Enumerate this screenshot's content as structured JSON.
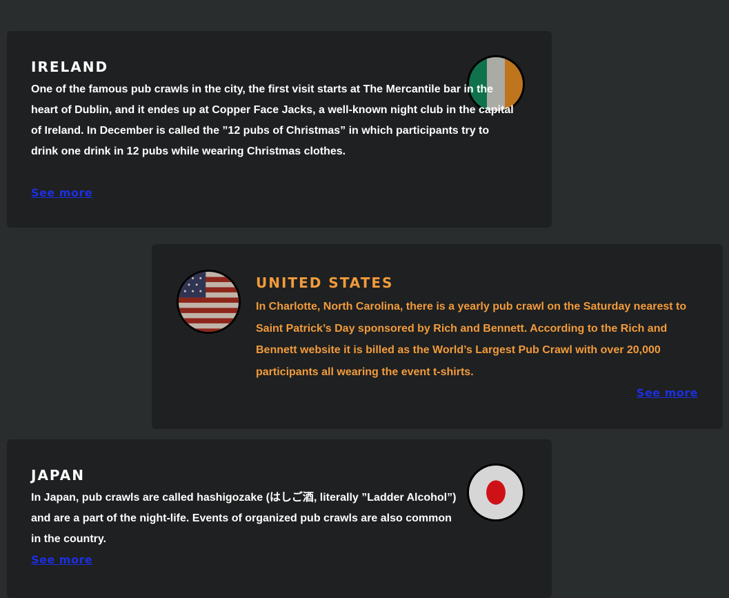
{
  "cards": {
    "ireland": {
      "title": "IRELAND",
      "body": "One of the famous pub crawls in the city, the first visit starts at The Mercantile bar in the heart of Dublin, and it endes up at Copper Face Jacks, a well-known night club in the capital of Ireland. In December is called the ”12 pubs of Christmas” in which participants try to drink one drink in 12 pubs while wearing Christmas clothes.",
      "link": "See more",
      "flag_icon": "ireland-flag-icon"
    },
    "united_states": {
      "title": "UNITED STATES",
      "body": "In Charlotte, North Carolina, there is a yearly pub crawl on the Saturday nearest to Saint Patrick’s Day sponsored by Rich and Bennett. According to the Rich and Bennett website it is billed as the World’s Largest Pub Crawl with over 20,000 participants all wearing the event t-shirts.",
      "link": "See more",
      "flag_icon": "usa-flag-icon"
    },
    "japan": {
      "title": "JAPAN",
      "body": "In Japan, pub crawls are called hashigozake (はしご酒, literally ”Ladder Alcohol”) and are a part of the night-life. Events of organized pub crawls are also common in the country.",
      "link": "See more",
      "flag_icon": "japan-flag-icon"
    }
  },
  "colors": {
    "background": "#292d2e",
    "card": "#1e2021",
    "text": "#ffffff",
    "accent": "#f29b3c",
    "link": "#1d2fe0"
  }
}
